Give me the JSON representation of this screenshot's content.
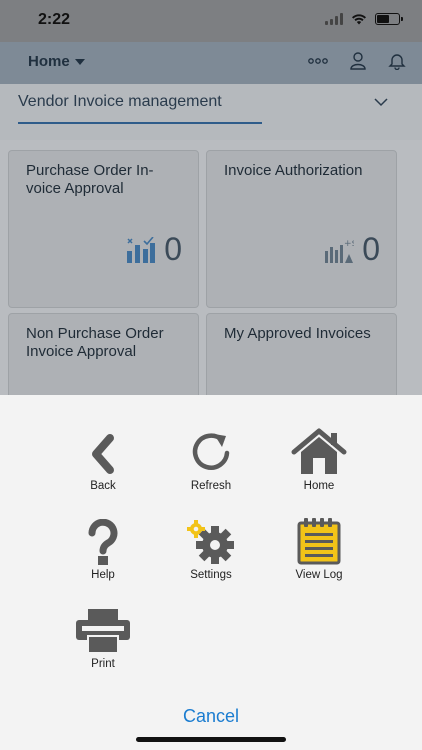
{
  "status": {
    "time": "2:22"
  },
  "shell": {
    "title": "Home"
  },
  "group": {
    "title": "Vendor Invoice management"
  },
  "tiles": [
    {
      "title": "Purchase Order In-voice Approval",
      "value": "0",
      "icon": "approval-chart-icon"
    },
    {
      "title": "Invoice Authorization",
      "value": "0",
      "icon": "money-chart-icon"
    },
    {
      "title": "Non Purchase Order Invoice Approval",
      "value": ""
    },
    {
      "title": "My Approved Invoices",
      "value": ""
    }
  ],
  "actions": {
    "back": "Back",
    "refresh": "Refresh",
    "home": "Home",
    "help": "Help",
    "settings": "Settings",
    "view_log": "View Log",
    "print": "Print"
  },
  "cancel_label": "Cancel",
  "colors": {
    "accent": "#1a7cd0",
    "icon": "#555555",
    "log_yellow": "#f2c318"
  }
}
